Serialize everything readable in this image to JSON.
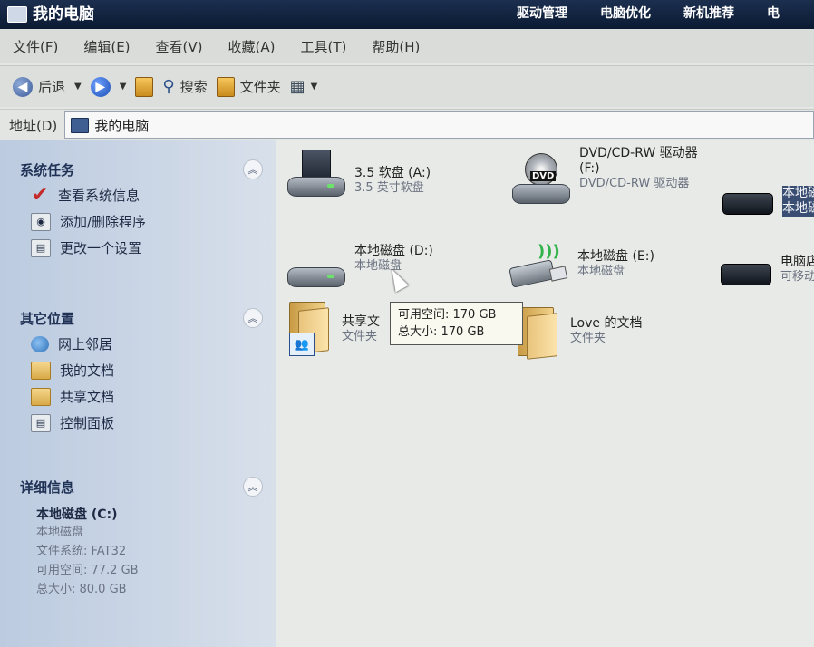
{
  "window": {
    "title": "我的电脑"
  },
  "top_tabs": [
    "",
    "",
    "驱动管理",
    "电脑优化",
    "新机推荐",
    "电"
  ],
  "menu": [
    "文件(F)",
    "编辑(E)",
    "查看(V)",
    "收藏(A)",
    "工具(T)",
    "帮助(H)"
  ],
  "toolbar": {
    "back": "后退",
    "search": "搜索",
    "folders": "文件夹"
  },
  "address": {
    "label": "地址(D)",
    "value": "我的电脑"
  },
  "sidebar": {
    "system_tasks": {
      "title": "系统任务",
      "items": [
        "查看系统信息",
        "添加/删除程序",
        "更改一个设置"
      ]
    },
    "other_places": {
      "title": "其它位置",
      "items": [
        "网上邻居",
        "我的文档",
        "共享文档",
        "控制面板"
      ]
    },
    "details": {
      "title": "详细信息",
      "name": "本地磁盘 (C:)",
      "type": "本地磁盘",
      "filesystem": "文件系统: FAT32",
      "free": "可用空间: 77.2 GB",
      "total": "总大小: 80.0 GB"
    }
  },
  "items": {
    "floppy": {
      "name": "3.5 软盘 (A:)",
      "sub": "3.5 英寸软盘"
    },
    "dvd": {
      "name": "DVD/CD-RW 驱动器",
      "name2": "(F:)",
      "sub": "DVD/CD-RW 驱动器"
    },
    "local_c": {
      "name": "本地磁",
      "sub": "本地磁"
    },
    "local_d": {
      "name": "本地磁盘 (D:)",
      "sub": "本地磁盘"
    },
    "local_e": {
      "name": "本地磁盘 (E:)",
      "sub": "本地磁盘"
    },
    "removable": {
      "name": "电脑店",
      "sub": "可移动"
    },
    "shared_docs": {
      "name": "共享文",
      "sub": "文件夹"
    },
    "love_docs": {
      "name": "Love 的文档",
      "sub": "文件夹"
    }
  },
  "tooltip": {
    "free": "可用空间: 170 GB",
    "total": "总大小: 170 GB"
  }
}
